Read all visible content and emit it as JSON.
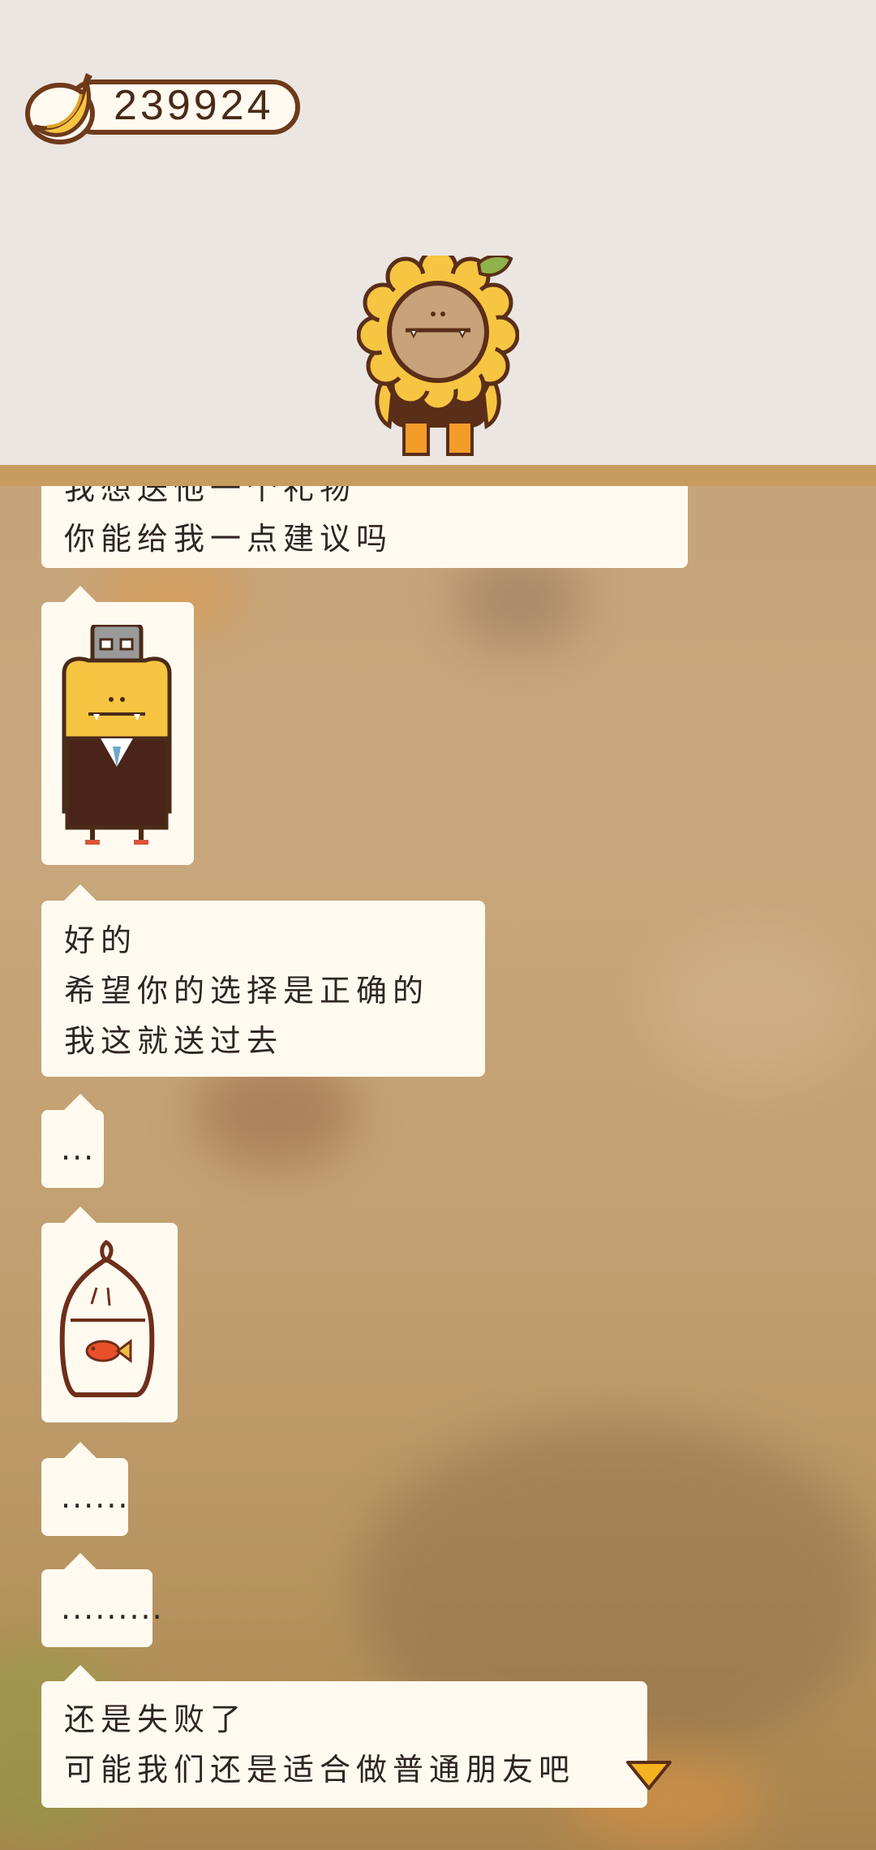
{
  "hud": {
    "banana_count": "239924",
    "banana_icon": "banana-icon"
  },
  "characters": {
    "top": "sunflower-character",
    "chat_image_1": "robot-business-suit-character",
    "chat_image_2": "goldfish-in-bag"
  },
  "messages": [
    {
      "lines": [
        "我想送他一个礼物",
        "你能给我一点建议吗"
      ]
    },
    {
      "image": "robot-business-suit-character"
    },
    {
      "lines": [
        "好的",
        "希望你的选择是正确的",
        "我这就送过去"
      ]
    },
    {
      "lines": [
        "..."
      ]
    },
    {
      "image": "goldfish-in-bag"
    },
    {
      "lines": [
        "......"
      ]
    },
    {
      "lines": [
        "........."
      ]
    },
    {
      "lines": [
        "还是失败了",
        "可能我们还是适合做普通朋友吧"
      ]
    }
  ],
  "colors": {
    "bubble": "#fffaf0",
    "divider": "#c89b5e",
    "outline": "#6e3a1a",
    "next_indicator": "#f5b21f"
  },
  "next_indicator_icon": "triangle-down-icon"
}
